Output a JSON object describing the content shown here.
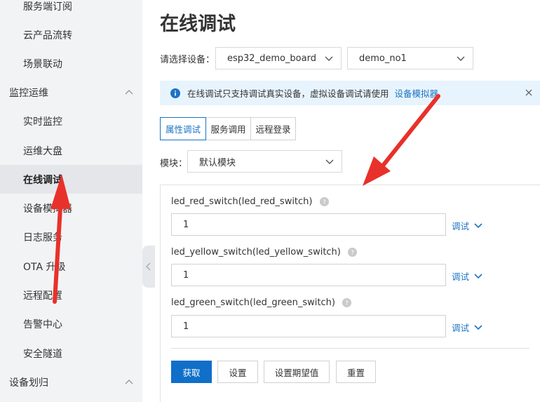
{
  "sidebar": {
    "items": [
      {
        "label": "服务端订阅"
      },
      {
        "label": "云产品流转"
      },
      {
        "label": "场景联动"
      },
      {
        "label": "监控运维"
      },
      {
        "label": "实时监控"
      },
      {
        "label": "运维大盘"
      },
      {
        "label": "在线调试"
      },
      {
        "label": "设备模拟器"
      },
      {
        "label": "日志服务"
      },
      {
        "label": "OTA 升级"
      },
      {
        "label": "远程配置"
      },
      {
        "label": "告警中心"
      },
      {
        "label": "安全隧道"
      },
      {
        "label": "设备划归"
      }
    ]
  },
  "main": {
    "title": "在线调试",
    "device_label": "请选择设备：",
    "product_select": "esp32_demo_board",
    "device_select": "demo_no1",
    "notice": {
      "text": "在线调试只支持调试真实设备，虚拟设备调试请使用",
      "link": "设备模拟器"
    },
    "tabs": [
      {
        "label": "属性调试"
      },
      {
        "label": "服务调用"
      },
      {
        "label": "远程登录"
      }
    ],
    "module_label": "模块：",
    "module_select": "默认模块",
    "properties": [
      {
        "label": "led_red_switch(led_red_switch)",
        "value": "1",
        "action": "调试"
      },
      {
        "label": "led_yellow_switch(led_yellow_switch)",
        "value": "1",
        "action": "调试"
      },
      {
        "label": "led_green_switch(led_green_switch)",
        "value": "1",
        "action": "调试"
      }
    ],
    "buttons": {
      "get": "获取",
      "set": "设置",
      "set_expected": "设置期望值",
      "reset": "重置"
    }
  },
  "colors": {
    "accent": "#1b73c4",
    "primary_button": "#0f6fc9",
    "annotation_arrow": "#e8312a",
    "notice_bg": "#e8f4fd",
    "sidebar_bg": "#f2f3f5"
  }
}
